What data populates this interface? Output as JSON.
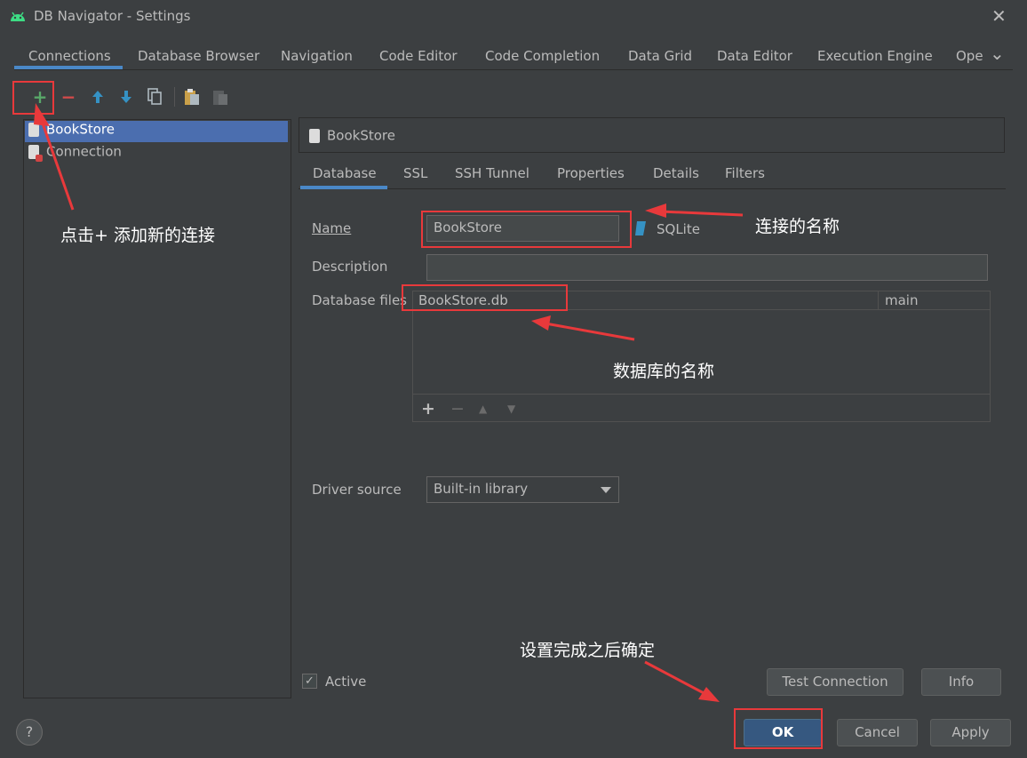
{
  "window": {
    "title": "DB Navigator - Settings",
    "close": "✕"
  },
  "top_tabs": [
    "Connections",
    "Database Browser",
    "Navigation",
    "Code Editor",
    "Code Completion",
    "Data Grid",
    "Data Editor",
    "Execution Engine",
    "Ope"
  ],
  "top_tabs_more": "⌄",
  "toolbar": {
    "add": "+",
    "remove": "−",
    "up": "🡅",
    "down": "🡇",
    "copy": "❐",
    "paste": "📋",
    "paste2": "▥"
  },
  "connections": [
    {
      "label": "BookStore",
      "selected": true
    },
    {
      "label": "Connection",
      "selected": false
    }
  ],
  "header": {
    "title": "BookStore"
  },
  "inner_tabs": [
    "Database",
    "SSL",
    "SSH Tunnel",
    "Properties",
    "Details",
    "Filters"
  ],
  "form": {
    "name_label": "Name",
    "name_value": "BookStore",
    "db_type": "SQLite",
    "description_label": "Description",
    "description_value": "",
    "files_label": "Database files",
    "file_path": "BookStore.db",
    "file_schema": "main",
    "table_tools": {
      "add": "+",
      "remove": "−",
      "up": "▲",
      "down": "▼"
    },
    "driver_label": "Driver source",
    "driver_value": "Built-in library"
  },
  "active": {
    "label": "Active",
    "checked": true,
    "mark": "✓"
  },
  "buttons": {
    "test": "Test Connection",
    "info": "Info",
    "ok": "OK",
    "cancel": "Cancel",
    "apply": "Apply",
    "help": "?"
  },
  "annotations": {
    "add": "点击+ 添加新的连接",
    "name": "连接的名称",
    "db": "数据库的名称",
    "ok": "设置完成之后确定"
  },
  "colors": {
    "accent": "#4a88c7",
    "selection": "#4b6eaf",
    "annotation_red": "#e8393b",
    "add_green": "#59a869"
  }
}
